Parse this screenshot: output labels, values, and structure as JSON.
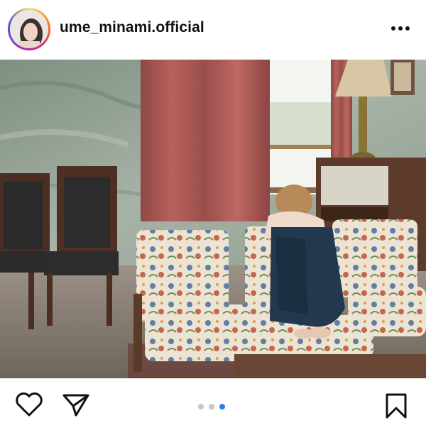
{
  "post": {
    "username": "ume_minami.official"
  },
  "header": {
    "avatar_icon": "avatar",
    "more_icon": "more-horizontal-icon"
  },
  "actions": {
    "like_icon": "heart-icon",
    "share_icon": "send-icon",
    "save_icon": "bookmark-icon"
  },
  "carousel": {
    "total": 3,
    "active_index": 2,
    "active_color": "#2b7fe8",
    "inactive_color": "#c7c7c7"
  }
}
